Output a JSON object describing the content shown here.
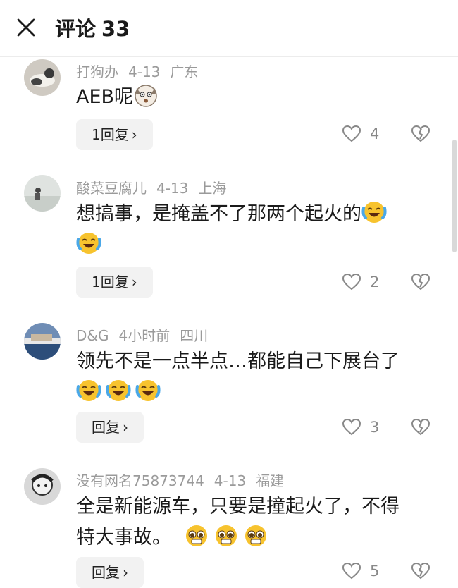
{
  "header": {
    "title": "评论",
    "count": "33"
  },
  "comments": [
    {
      "user": "打狗办",
      "date": "4-13",
      "location": "广东",
      "text_lines": [
        "AEB呢"
      ],
      "emojis_line1": 1,
      "emoji_line2": 0,
      "reply_label": "1回复",
      "likes": "4",
      "emoji_type": "dog"
    },
    {
      "user": "酸菜豆腐儿",
      "date": "4-13",
      "location": "上海",
      "text_lines": [
        "想搞事，是掩盖不了那两个起火的"
      ],
      "reply_label": "1回复",
      "likes": "2",
      "emoji_type": "laugh-cry"
    },
    {
      "user": "D&G",
      "date": "4小时前",
      "location": "四川",
      "text_lines": [
        "领先不是一点半点…都能自己下展台了"
      ],
      "reply_label": "回复",
      "likes": "3",
      "emoji_type": "laugh-cry"
    },
    {
      "user": "没有网名75873744",
      "date": "4-13",
      "location": "福建",
      "text_lines": [
        "全是新能源车，只要是撞起火了，不得",
        "特大事故。"
      ],
      "reply_label": "回复",
      "likes": "5",
      "emoji_type": "pleading"
    }
  ],
  "icons": {
    "close": "close-icon",
    "like": "heart-icon",
    "dislike": "broken-heart-icon",
    "chevron": "chevron-right-icon"
  },
  "colors": {
    "meta": "#9a9a9a",
    "reply_bg": "#f2f2f2",
    "emoji_yellow": "#f7c32e"
  }
}
